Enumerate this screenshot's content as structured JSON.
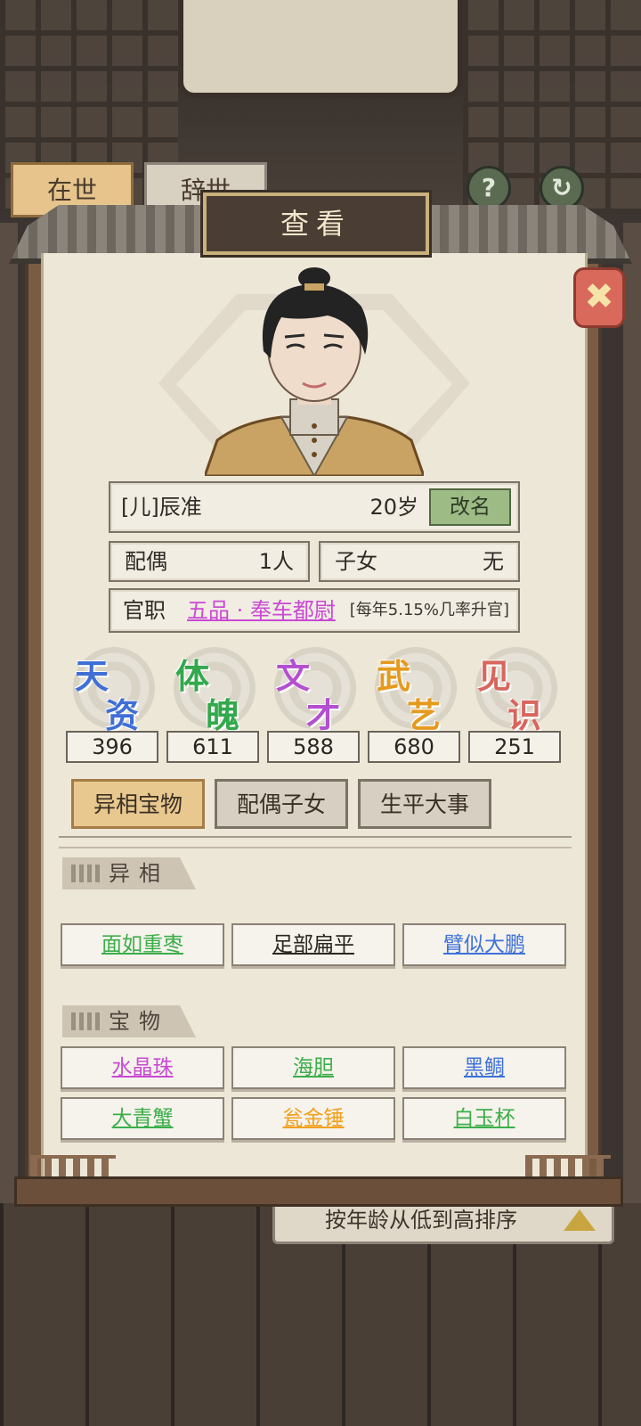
{
  "background": {
    "tabs": [
      "在世",
      "辞世"
    ],
    "help_icon": "?",
    "sort_label": "按年龄从低到高排序"
  },
  "dialog": {
    "title": "查看",
    "close_icon": "close-icon"
  },
  "person": {
    "name": "[儿]辰准",
    "age": "20岁",
    "rename_label": "改名",
    "spouse_label": "配偶",
    "spouse_value": "1人",
    "children_label": "子女",
    "children_value": "无",
    "office_label": "官职",
    "office_value": "五品 · 奉车都尉",
    "office_rate": "[每年5.15%几率升官]"
  },
  "attributes": [
    {
      "c1": "天",
      "c2": "资",
      "value": "396",
      "color": "#3f6fd6"
    },
    {
      "c1": "体",
      "c2": "魄",
      "value": "611",
      "color": "#33a84c"
    },
    {
      "c1": "文",
      "c2": "才",
      "value": "588",
      "color": "#b44fd0"
    },
    {
      "c1": "武",
      "c2": "艺",
      "value": "680",
      "color": "#e59a1f"
    },
    {
      "c1": "见",
      "c2": "识",
      "value": "251",
      "color": "#d8665d"
    }
  ],
  "tabs": [
    "异相宝物",
    "配偶子女",
    "生平大事"
  ],
  "sections": {
    "traits_title": "异相",
    "treasures_title": "宝物"
  },
  "traits": [
    {
      "label": "面如重枣",
      "color": "#3cae4a"
    },
    {
      "label": "足部扁平",
      "color": "#2b2621"
    },
    {
      "label": "臂似大鹏",
      "color": "#3f72d9"
    }
  ],
  "treasures": [
    {
      "label": "水晶珠",
      "color": "#c94ad3"
    },
    {
      "label": "海胆",
      "color": "#3cae4a"
    },
    {
      "label": "黑鲷",
      "color": "#3f72d9"
    },
    {
      "label": "大青蟹",
      "color": "#3cae4a"
    },
    {
      "label": "瓮金锤",
      "color": "#f0a11e"
    },
    {
      "label": "白玉杯",
      "color": "#3cae4a"
    }
  ]
}
